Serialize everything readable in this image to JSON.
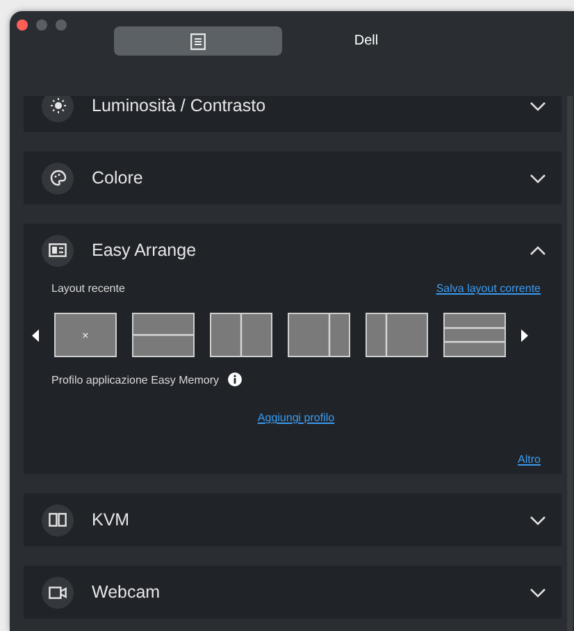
{
  "window": {
    "traffic_lights": [
      {
        "color": "#ff5f57"
      },
      {
        "color": "#5b5f64"
      },
      {
        "color": "#5b5f64"
      }
    ]
  },
  "tabs": [
    {
      "kind": "icon",
      "selected": true
    },
    {
      "kind": "text",
      "label": "Dell",
      "selected": false
    }
  ],
  "sections": [
    {
      "kind": "brightness",
      "title": "Luminosità / Contrasto",
      "expanded": false
    },
    {
      "kind": "color",
      "title": "Colore",
      "expanded": false
    },
    {
      "kind": "arrange",
      "title": "Easy Arrange",
      "expanded": true,
      "content": {
        "recent_label": "Layout recente",
        "save_link": "Salva layout corrente",
        "layouts": [
          {
            "kind": "empty",
            "mark": "×"
          },
          {
            "kind": "two-rows"
          },
          {
            "kind": "two-cols"
          },
          {
            "kind": "wide-left"
          },
          {
            "kind": "wide-right"
          },
          {
            "kind": "three-rows"
          }
        ],
        "profile_label": "Profilo applicazione Easy Memory",
        "add_profile_link": "Aggiungi profilo",
        "more_link": "Altro"
      }
    },
    {
      "kind": "kvm",
      "title": "KVM",
      "expanded": false
    },
    {
      "kind": "webcam",
      "title": "Webcam",
      "expanded": false
    }
  ]
}
